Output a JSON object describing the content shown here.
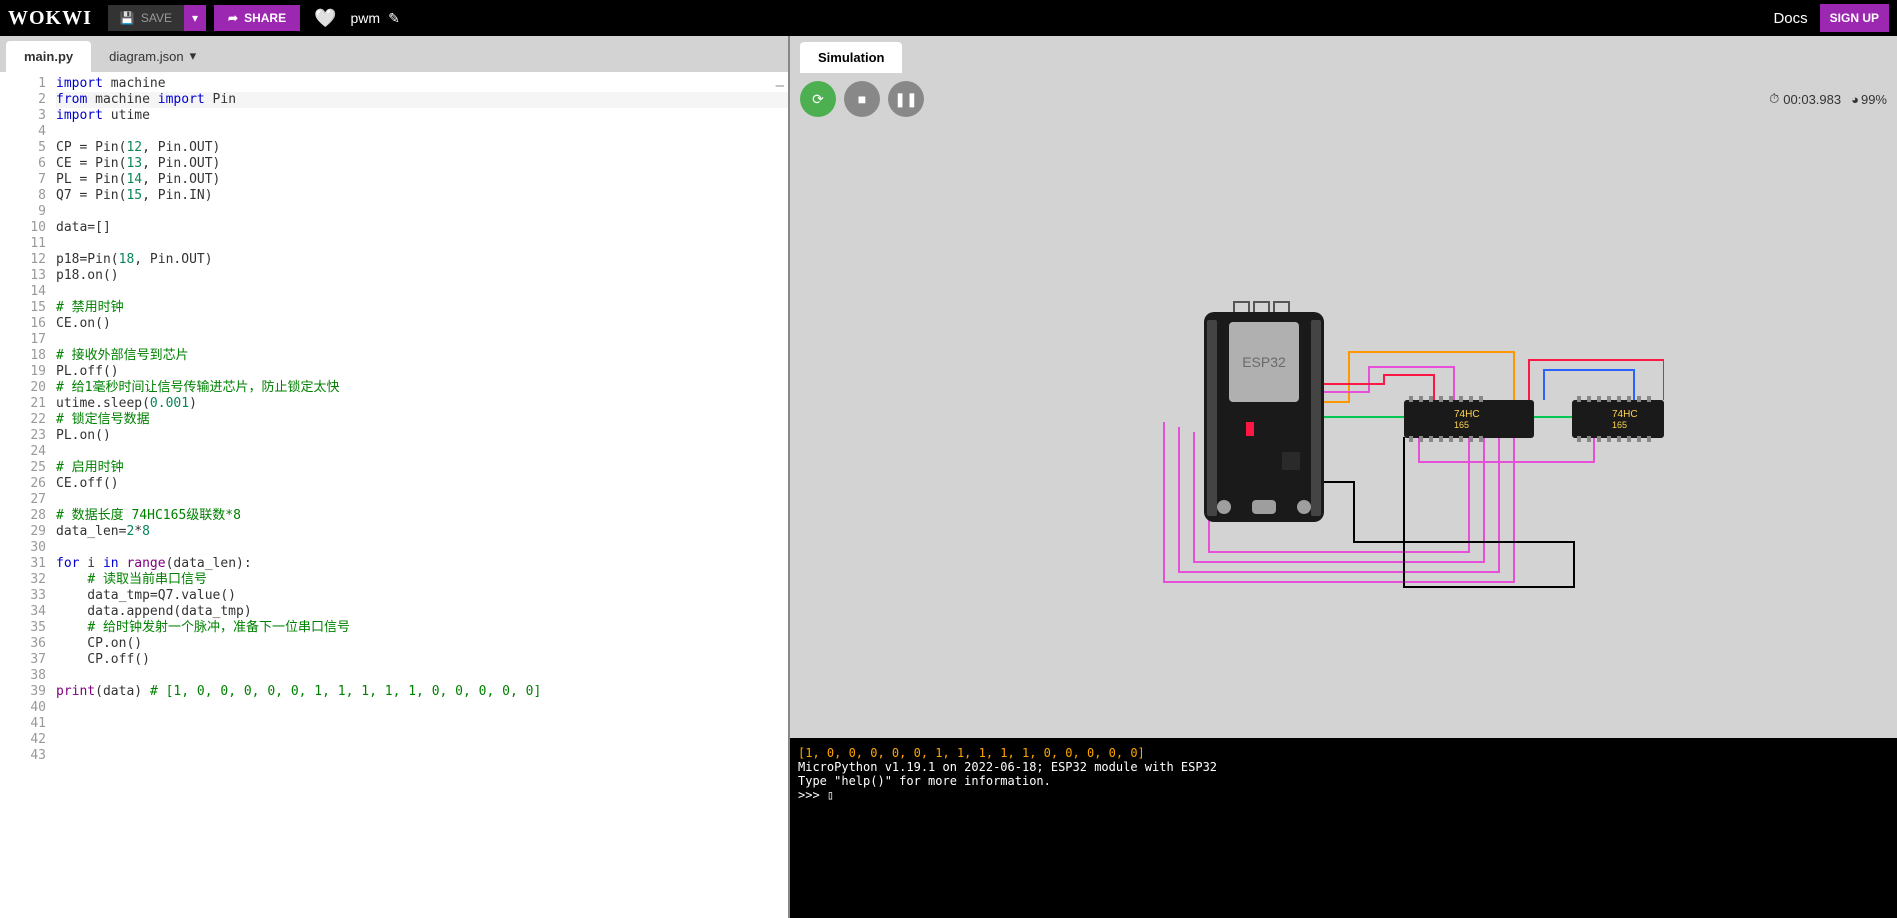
{
  "topbar": {
    "logo": "WOKWI",
    "save_label": "SAVE",
    "share_label": "SHARE",
    "project_name": "pwm",
    "docs_label": "Docs",
    "signup_label": "SIGN UP"
  },
  "tabs": [
    {
      "label": "main.py",
      "active": true
    },
    {
      "label": "diagram.json",
      "active": false
    }
  ],
  "simulation": {
    "tab_label": "Simulation",
    "time": "00:03.983",
    "perf": "99%"
  },
  "board": {
    "mcu_label": "ESP32",
    "chip_label": "74HC165"
  },
  "terminal": {
    "lines": [
      {
        "text": "[1, 0, 0, 0, 0, 0, 1, 1, 1, 1, 1, 0, 0, 0, 0, 0]",
        "cls": "term-orange"
      },
      {
        "text": "MicroPython v1.19.1 on 2022-06-18; ESP32 module with ESP32",
        "cls": ""
      },
      {
        "text": "Type \"help()\" for more information.",
        "cls": ""
      },
      {
        "text": ">>> ▯",
        "cls": ""
      }
    ]
  },
  "code": {
    "lines": [
      "<span class='kw'>import</span> machine",
      "<span class='kw'>from</span> machine <span class='kw'>import</span> Pin",
      "<span class='kw'>import</span> utime",
      "",
      "CP = Pin(<span class='num'>12</span>, Pin.OUT)",
      "CE = Pin(<span class='num'>13</span>, Pin.OUT)",
      "PL = Pin(<span class='num'>14</span>, Pin.OUT)",
      "Q7 = Pin(<span class='num'>15</span>, Pin.IN)",
      "",
      "data=[]",
      "",
      "p18=Pin(<span class='num'>18</span>, Pin.OUT)",
      "p18.on()",
      "",
      "<span class='com'># 禁用时钟</span>",
      "CE.on()",
      "",
      "<span class='com'># 接收外部信号到芯片</span>",
      "PL.off()",
      "<span class='com'># 给1毫秒时间让信号传输进芯片，防止锁定太快</span>",
      "utime.sleep(<span class='num'>0.001</span>)",
      "<span class='com'># 锁定信号数据</span>",
      "PL.on()",
      "",
      "<span class='com'># 启用时钟</span>",
      "CE.off()",
      "",
      "<span class='com'># 数据长度 74HC165级联数*8</span>",
      "data_len=<span class='num'>2</span>*<span class='num'>8</span>",
      "",
      "<span class='kw'>for</span> i <span class='kw'>in</span> <span class='kw2'>range</span>(data_len):",
      "    <span class='com'># 读取当前串口信号</span>",
      "    data_tmp=Q7.value()",
      "    data.append(data_tmp)",
      "    <span class='com'># 给时钟发射一个脉冲，准备下一位串口信号</span>",
      "    CP.on()",
      "    CP.off()",
      "",
      "<span class='kw2'>print</span>(data) <span class='com'># [1, 0, 0, 0, 0, 0, 1, 1, 1, 1, 1, 0, 0, 0, 0, 0]</span>",
      "",
      "",
      "",
      ""
    ]
  }
}
